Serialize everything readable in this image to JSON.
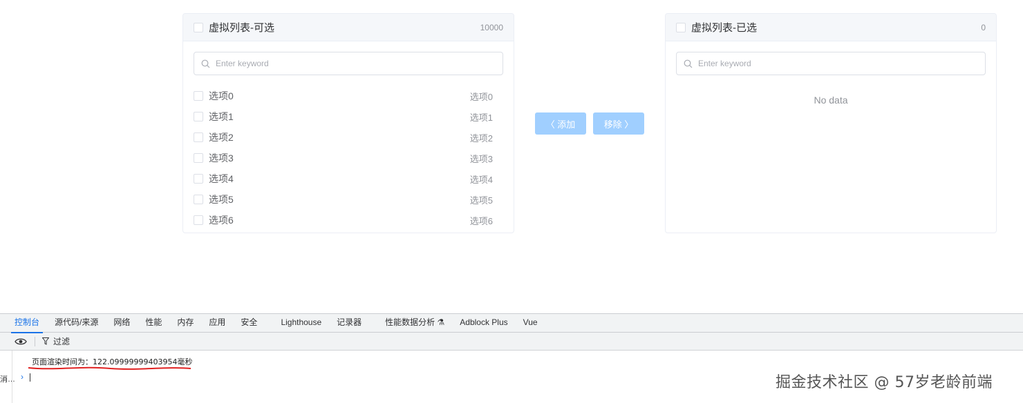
{
  "transfer": {
    "left_panel": {
      "title": "虚拟列表-可选",
      "count": "10000",
      "search_placeholder": "Enter keyword",
      "items": [
        {
          "label": "选项0",
          "right": "选项0"
        },
        {
          "label": "选项1",
          "right": "选项1"
        },
        {
          "label": "选项2",
          "right": "选项2"
        },
        {
          "label": "选项3",
          "right": "选项3"
        },
        {
          "label": "选项4",
          "right": "选项4"
        },
        {
          "label": "选项5",
          "right": "选项5"
        },
        {
          "label": "选项6",
          "right": "选项6"
        }
      ]
    },
    "right_panel": {
      "title": "虚拟列表-已选",
      "count": "0",
      "search_placeholder": "Enter keyword",
      "empty_text": "No data"
    },
    "buttons": {
      "add_label": "〈 添加",
      "remove_label": "移除 〉"
    }
  },
  "devtools": {
    "tabs": [
      "控制台",
      "源代码/来源",
      "网络",
      "性能",
      "内存",
      "应用",
      "安全",
      "Lighthouse",
      "记录器",
      "性能数据分析 ⚗",
      "Adblock Plus",
      "Vue"
    ],
    "active_tab": "控制台",
    "filter_label": "过滤",
    "log_message": "页面渲染时间为：122.09999999403954毫秒",
    "truncated_left_text": "消…"
  },
  "watermark": "掘金技术社区 @ 57岁老龄前端",
  "colors": {
    "primary_disabled": "#a0cfff",
    "devtools_accent": "#1a73e8",
    "annotation_red": "#e02020"
  }
}
